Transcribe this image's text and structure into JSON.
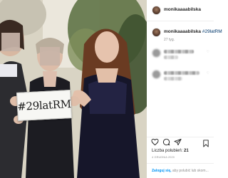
{
  "post": {
    "username": "monikaaaabilska",
    "caption_tag": "#29latRM",
    "age": "27 tyg.",
    "likes_label": "Liczba polubień:",
    "likes_count": "21",
    "date": "4 GRUDNIA 2020"
  },
  "photo": {
    "sign_text": "#29latRM"
  },
  "login": {
    "link_label": "Zaloguj się,",
    "rest": " aby polubić lub skom..."
  },
  "icons": [
    "heart-icon",
    "comment-icon",
    "share-icon",
    "bookmark-icon"
  ],
  "colors": {
    "link": "#0095f6",
    "text": "#262626",
    "muted": "#8e8e8e"
  }
}
